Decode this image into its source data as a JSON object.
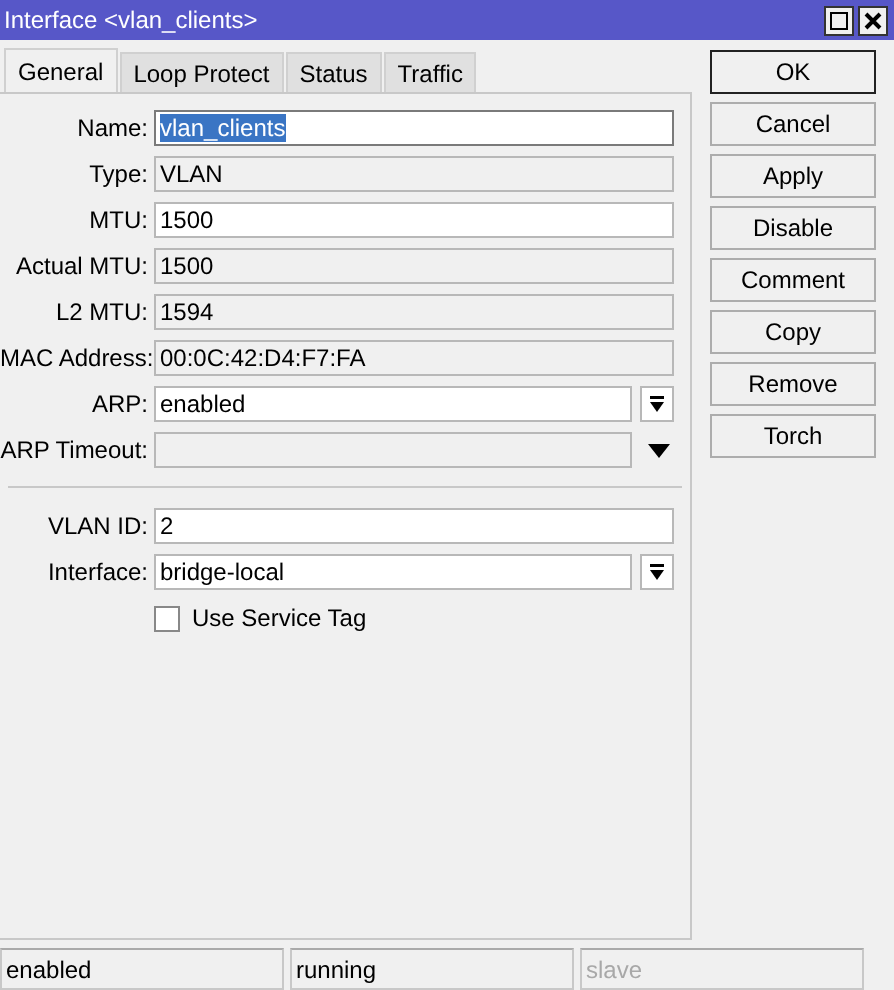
{
  "window": {
    "title": "Interface <vlan_clients>"
  },
  "tabs": [
    {
      "label": "General",
      "selected": true
    },
    {
      "label": "Loop Protect",
      "selected": false
    },
    {
      "label": "Status",
      "selected": false
    },
    {
      "label": "Traffic",
      "selected": false
    }
  ],
  "fields": [
    {
      "label": "Name:",
      "value": "vlan_clients",
      "kind": "text",
      "highlighted": true
    },
    {
      "label": "Type:",
      "value": "VLAN",
      "kind": "readonly",
      "highlighted": false
    },
    {
      "label": "MTU:",
      "value": "1500",
      "kind": "text",
      "highlighted": false
    },
    {
      "label": "Actual MTU:",
      "value": "1500",
      "kind": "readonly",
      "highlighted": false
    },
    {
      "label": "L2 MTU:",
      "value": "1594",
      "kind": "readonly",
      "highlighted": false
    },
    {
      "label": "MAC Address:",
      "value": "00:0C:42:D4:F7:FA",
      "kind": "readonly",
      "highlighted": false
    },
    {
      "label": "ARP:",
      "value": "enabled",
      "kind": "combo",
      "highlighted": false
    },
    {
      "label": "ARP Timeout:",
      "kind": "readonly_combo"
    },
    {
      "kind": "separator"
    },
    {
      "label": "VLAN ID:",
      "value": "2",
      "kind": "text",
      "highlighted": false
    },
    {
      "label": "Interface:",
      "value": "bridge-local",
      "kind": "combo",
      "highlighted": false
    },
    {
      "label": "Use Service Tag",
      "kind": "checkbox",
      "checked": false
    }
  ],
  "buttons": [
    {
      "label": "OK",
      "default": true
    },
    {
      "label": "Cancel",
      "default": false
    },
    {
      "label": "Apply",
      "default": false
    },
    {
      "label": "Disable",
      "default": false
    },
    {
      "label": "Comment",
      "default": false
    },
    {
      "label": "Copy",
      "default": false
    },
    {
      "label": "Remove",
      "default": false
    },
    {
      "label": "Torch",
      "default": false
    }
  ],
  "status_bar": [
    {
      "text": "enabled",
      "disabled": false
    },
    {
      "text": "running",
      "disabled": false
    },
    {
      "text": "slave",
      "disabled": true
    }
  ]
}
